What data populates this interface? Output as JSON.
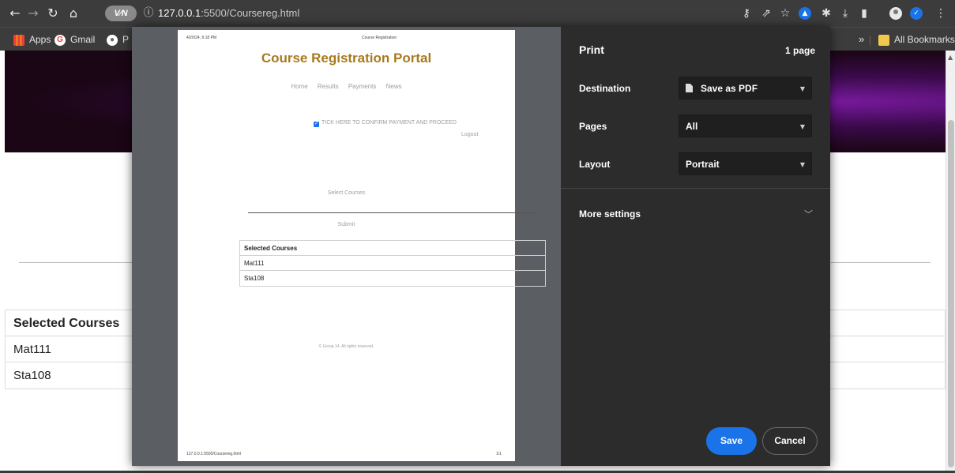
{
  "browser": {
    "url_host": "127.0.0.1",
    "url_path": ":5500/Coursereg.html",
    "vpn_label": "V⁄N"
  },
  "bookmarks": {
    "apps": "Apps",
    "gmail": "Gmail",
    "truncated": "P",
    "all_bookmarks": "All Bookmarks",
    "overflow": "»"
  },
  "page": {
    "table_header": "Selected Courses",
    "rows": [
      "Mat111",
      "Sta108"
    ]
  },
  "print_preview": {
    "date_time": "4/20/24, 6:18 PM",
    "doc_title": "Course Registration",
    "heading": "Course Registration Portal",
    "nav": [
      "Home",
      "Results",
      "Payments",
      "News"
    ],
    "checkbox_label": "TICK HERE TO CONFIRM PAYMENT AND PROCEED",
    "logout": "Logout",
    "select_courses": "Select Courses",
    "submit": "Submit",
    "table_header": "Selected Courses",
    "rows": [
      "Mat111",
      "Sta108"
    ],
    "footer": "© Group 14. All rights reserved.",
    "page_url": "127.0.0.1:5500/Coursereg.html",
    "page_number": "1/1"
  },
  "print_settings": {
    "title": "Print",
    "page_count": "1 page",
    "destination_label": "Destination",
    "destination_value": "Save as PDF",
    "pages_label": "Pages",
    "pages_value": "All",
    "layout_label": "Layout",
    "layout_value": "Portrait",
    "more_settings": "More settings",
    "save": "Save",
    "cancel": "Cancel"
  },
  "colors": {
    "accent": "#1a73e8",
    "heading": "#a8791e",
    "dialog_panel": "#2c2c2c"
  }
}
